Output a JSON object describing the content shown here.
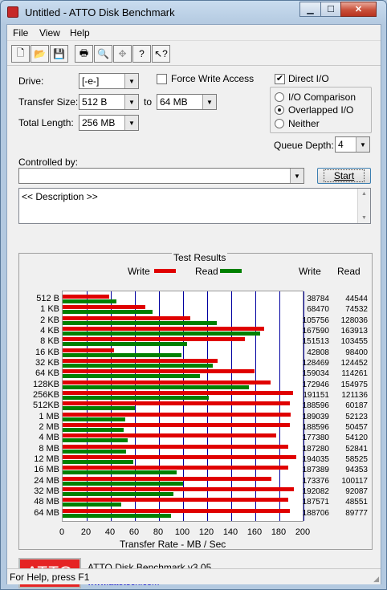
{
  "window": {
    "title": "Untitled - ATTO Disk Benchmark"
  },
  "menu": {
    "items": [
      "File",
      "View",
      "Help"
    ]
  },
  "toolbar": {
    "icons": [
      "new-icon",
      "open-icon",
      "save-icon",
      "print-icon",
      "print-preview-icon",
      "move-icon",
      "help-icon",
      "context-help-icon"
    ]
  },
  "form": {
    "drive_label": "Drive:",
    "drive_value": "[-e-]",
    "transfer_size_label": "Transfer Size:",
    "transfer_from": "512 B",
    "to_label": "to",
    "transfer_to": "64 MB",
    "total_length_label": "Total Length:",
    "total_length": "256 MB",
    "force_write_label": "Force Write Access",
    "force_write_checked": false,
    "direct_io_label": "Direct I/O",
    "direct_io_checked": true,
    "io_comparison_label": "I/O Comparison",
    "overlapped_io_label": "Overlapped I/O",
    "neither_label": "Neither",
    "io_mode_selected": "Overlapped I/O",
    "queue_depth_label": "Queue Depth:",
    "queue_depth": "4",
    "controlled_by_label": "Controlled by:",
    "controlled_by_value": "",
    "start_label": "Start",
    "description": "<< Description >>"
  },
  "results": {
    "title": "Test Results",
    "legend_write": "Write",
    "legend_read": "Read",
    "col_write": "Write",
    "col_read": "Read",
    "xlabel": "Transfer Rate - MB / Sec",
    "write_color": "#e00000",
    "read_color": "#008000"
  },
  "chart_data": {
    "type": "bar",
    "orientation": "horizontal",
    "title": "Test Results",
    "xlabel": "Transfer Rate - MB / Sec",
    "xlim": [
      0,
      200
    ],
    "xticks": [
      0,
      20,
      40,
      60,
      80,
      100,
      120,
      140,
      160,
      180,
      200
    ],
    "categories": [
      "512 B",
      "1 KB",
      "2 KB",
      "4 KB",
      "8 KB",
      "16 KB",
      "32 KB",
      "64 KB",
      "128KB",
      "256KB",
      "512KB",
      "1 MB",
      "2 MB",
      "4 MB",
      "8 MB",
      "12 MB",
      "16 MB",
      "24 MB",
      "32 MB",
      "48 MB",
      "64 MB"
    ],
    "series": [
      {
        "name": "Write",
        "values": [
          38784,
          68470,
          105756,
          167590,
          151513,
          42808,
          128469,
          159034,
          172946,
          191151,
          188596,
          189039,
          188596,
          177380,
          187280,
          194035,
          187389,
          173376,
          192082,
          187571,
          188706
        ]
      },
      {
        "name": "Read",
        "values": [
          44544,
          74532,
          128036,
          163913,
          103455,
          98400,
          124452,
          114261,
          154975,
          121136,
          60187,
          52123,
          50457,
          54120,
          52841,
          58525,
          94353,
          100117,
          92087,
          48551,
          89777
        ]
      }
    ]
  },
  "footer": {
    "logo_text": "ATTO",
    "product": "ATTO Disk Benchmark v3.05",
    "url": "www.attotech.com"
  },
  "status": {
    "text": "For Help, press F1"
  }
}
